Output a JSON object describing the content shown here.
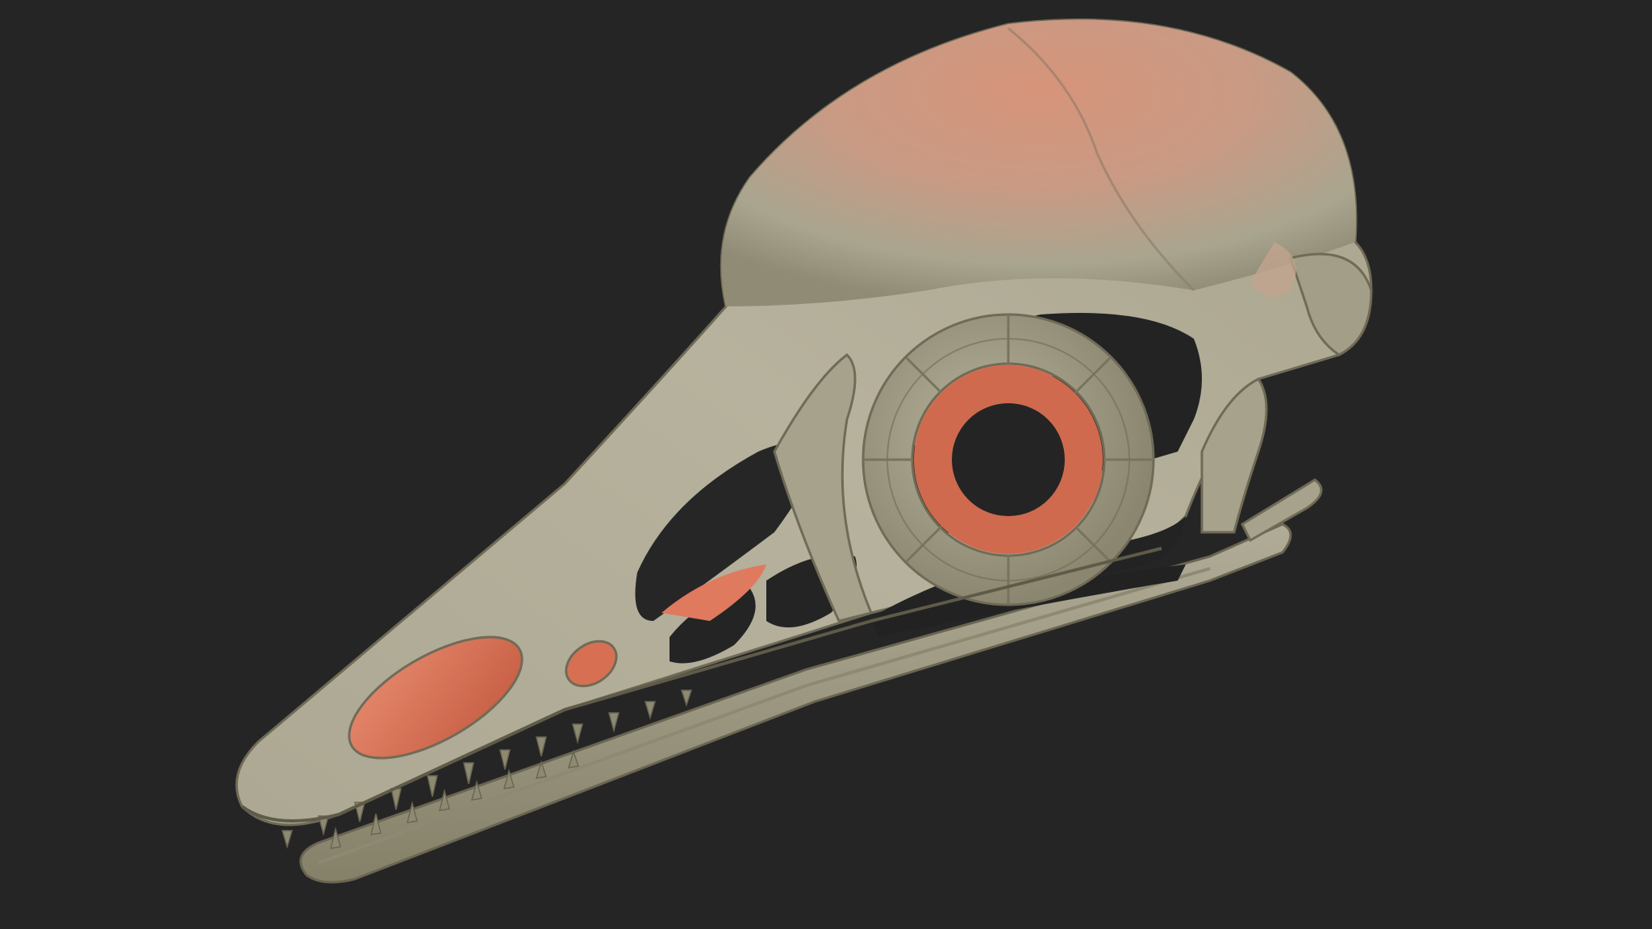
{
  "scene": {
    "subject": "skull-render",
    "background_color": "#252525",
    "colors": {
      "bone_light": "#b9b5a1",
      "bone_mid": "#9c9882",
      "bone_dark": "#6f6b57",
      "flesh_orange": "#e17d62",
      "flesh_deep": "#c65c42",
      "tooth": "#8e8a72"
    }
  }
}
